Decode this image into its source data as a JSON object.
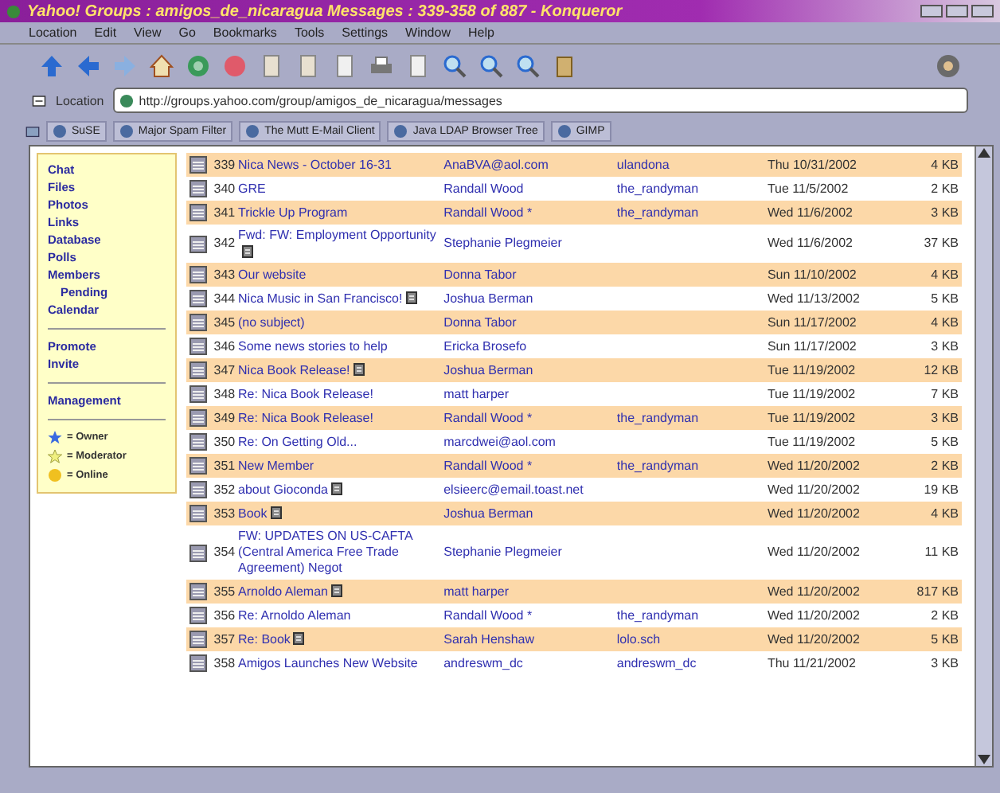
{
  "window": {
    "title": "Yahoo! Groups : amigos_de_nicaragua Messages : 339-358 of 887 - Konqueror"
  },
  "menu_bar": [
    "Location",
    "Edit",
    "View",
    "Go",
    "Bookmarks",
    "Tools",
    "Settings",
    "Window",
    "Help"
  ],
  "location_bar": {
    "label": "Location",
    "url": "http://groups.yahoo.com/group/amigos_de_nicaragua/messages"
  },
  "bookmarks_bar": [
    "SuSE",
    "Major Spam Filter",
    "The Mutt E-Mail Client",
    "Java LDAP Browser Tree",
    "GIMP"
  ],
  "sidebar": {
    "sections": [
      {
        "items": [
          {
            "label": "Chat"
          },
          {
            "label": "Files"
          },
          {
            "label": "Photos"
          },
          {
            "label": "Links"
          },
          {
            "label": "Database"
          },
          {
            "label": "Polls"
          },
          {
            "label": "Members",
            "children": [
              {
                "label": "Pending"
              }
            ]
          },
          {
            "label": "Calendar"
          }
        ]
      },
      {
        "items": [
          {
            "label": "Promote"
          },
          {
            "label": "Invite"
          }
        ]
      },
      {
        "items": [
          {
            "label": "Management"
          }
        ]
      }
    ],
    "legend": [
      {
        "kind": "owner",
        "label": "= Owner"
      },
      {
        "kind": "moderator",
        "label": "= Moderator"
      },
      {
        "kind": "online",
        "label": "= Online"
      }
    ]
  },
  "messages": [
    {
      "number": "339",
      "subject": "Nica News - October 16-31",
      "attachment": false,
      "author": "AnaBVA@aol.com",
      "profile": "ulandona",
      "date": "Thu 10/31/2002",
      "size": "4 KB"
    },
    {
      "number": "340",
      "subject": "GRE",
      "attachment": false,
      "author": "Randall Wood",
      "profile": "the_randyman",
      "date": "Tue 11/5/2002",
      "size": "2 KB"
    },
    {
      "number": "341",
      "subject": "Trickle Up Program",
      "attachment": false,
      "author": "Randall Wood *",
      "profile": "the_randyman",
      "date": "Wed 11/6/2002",
      "size": "3 KB"
    },
    {
      "number": "342",
      "subject": "Fwd: FW: Employment Opportunity",
      "attachment": true,
      "author": "Stephanie Plegmeier",
      "date": "Wed 11/6/2002",
      "size": "37 KB"
    },
    {
      "number": "343",
      "subject": "Our website",
      "attachment": false,
      "author": "Donna Tabor",
      "date": "Sun 11/10/2002",
      "size": "4 KB"
    },
    {
      "number": "344",
      "subject": "Nica Music in San Francisco!",
      "attachment": true,
      "author": "Joshua Berman",
      "date": "Wed 11/13/2002",
      "size": "5 KB"
    },
    {
      "number": "345",
      "subject": "(no subject)",
      "attachment": false,
      "author": "Donna Tabor",
      "date": "Sun 11/17/2002",
      "size": "4 KB"
    },
    {
      "number": "346",
      "subject": "Some news stories to help",
      "attachment": false,
      "author": "Ericka Brosefo",
      "date": "Sun 11/17/2002",
      "size": "3 KB"
    },
    {
      "number": "347",
      "subject": "Nica Book Release!",
      "attachment": true,
      "author": "Joshua Berman",
      "date": "Tue 11/19/2002",
      "size": "12 KB"
    },
    {
      "number": "348",
      "subject": "Re: Nica Book Release!",
      "attachment": false,
      "author": "matt harper",
      "date": "Tue 11/19/2002",
      "size": "7 KB"
    },
    {
      "number": "349",
      "subject": "Re: Nica Book Release!",
      "attachment": false,
      "author": "Randall Wood *",
      "profile": "the_randyman",
      "date": "Tue 11/19/2002",
      "size": "3 KB"
    },
    {
      "number": "350",
      "subject": "Re: On Getting Old...",
      "attachment": false,
      "author": "marcdwei@aol.com",
      "date": "Tue 11/19/2002",
      "size": "5 KB"
    },
    {
      "number": "351",
      "subject": "New Member",
      "attachment": false,
      "author": "Randall Wood *",
      "profile": "the_randyman",
      "date": "Wed 11/20/2002",
      "size": "2 KB"
    },
    {
      "number": "352",
      "subject": "about Gioconda",
      "attachment": true,
      "author": "elsieerc@email.toast.net",
      "date": "Wed 11/20/2002",
      "size": "19 KB"
    },
    {
      "number": "353",
      "subject": "Book",
      "attachment": true,
      "author": "Joshua Berman",
      "date": "Wed 11/20/2002",
      "size": "4 KB"
    },
    {
      "number": "354",
      "subject": "FW: UPDATES ON US-CAFTA (Central America Free Trade Agreement) Negot",
      "attachment": false,
      "author": "Stephanie Plegmeier",
      "date": "Wed 11/20/2002",
      "size": "11 KB"
    },
    {
      "number": "355",
      "subject": "Arnoldo Aleman",
      "attachment": true,
      "author": "matt harper",
      "date": "Wed 11/20/2002",
      "size": "817 KB"
    },
    {
      "number": "356",
      "subject": "Re: Arnoldo Aleman",
      "attachment": false,
      "author": "Randall Wood *",
      "profile": "the_randyman",
      "date": "Wed 11/20/2002",
      "size": "2 KB"
    },
    {
      "number": "357",
      "subject": "Re: Book",
      "attachment": true,
      "author": "Sarah Henshaw",
      "profile": "lolo.sch",
      "date": "Wed 11/20/2002",
      "size": "5 KB"
    },
    {
      "number": "358",
      "subject": "Amigos Launches New Website",
      "attachment": false,
      "author": "andreswm_dc",
      "profile": "andreswm_dc",
      "date": "Thu 11/21/2002",
      "size": "3 KB"
    }
  ]
}
